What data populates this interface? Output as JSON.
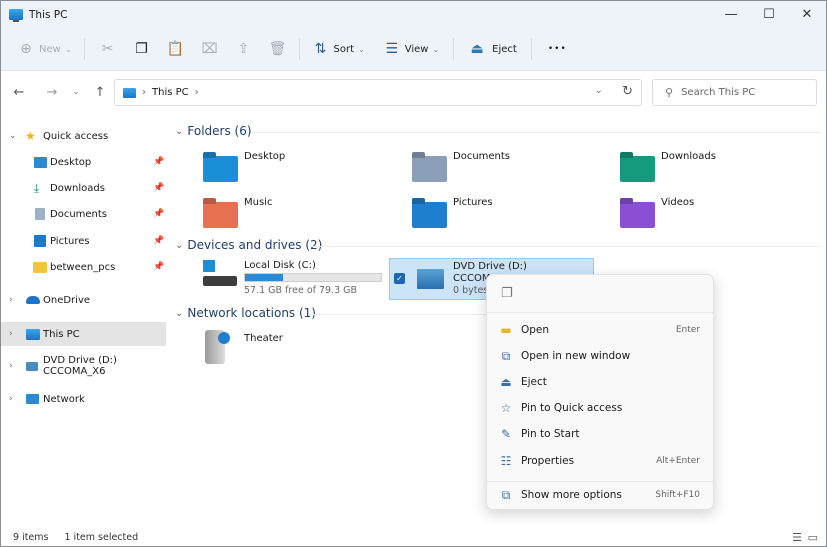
{
  "window": {
    "title": "This PC",
    "minimize": "—",
    "maximize": "☐",
    "close": "✕"
  },
  "toolbar": {
    "new_label": "New",
    "sort_label": "Sort",
    "view_label": "View",
    "eject_label": "Eject",
    "more_label": "•••",
    "icons": [
      "cut-icon",
      "copy-icon",
      "paste-icon",
      "rename-icon",
      "share-icon",
      "delete-icon"
    ]
  },
  "nav": {
    "back": "←",
    "forward": "→",
    "recent": "⌄",
    "up": "↑"
  },
  "address": {
    "crumbs": [
      "This PC"
    ],
    "sep": "›"
  },
  "search": {
    "placeholder": "Search This PC"
  },
  "sidebar": {
    "quick_access": "Quick access",
    "quick_items": [
      {
        "label": "Desktop",
        "color": "#2a8ad4"
      },
      {
        "label": "Downloads",
        "color": "#16907a"
      },
      {
        "label": "Documents",
        "color": "#8fa3bb"
      },
      {
        "label": "Pictures",
        "color": "#1f78cf"
      },
      {
        "label": "between_pcs",
        "color": "#f2c53d"
      }
    ],
    "roots": [
      {
        "label": "OneDrive"
      },
      {
        "label": "This PC",
        "selected": true
      },
      {
        "label": "DVD Drive (D:) CCCOMA_X6"
      },
      {
        "label": "Network"
      }
    ]
  },
  "content": {
    "folders_header": "Folders (6)",
    "folders": [
      {
        "name": "Desktop",
        "color": "#1b8fd6"
      },
      {
        "name": "Documents",
        "color": "#8c9fb8"
      },
      {
        "name": "Downloads",
        "color": "#149a7c"
      },
      {
        "name": "Music",
        "color": "#e6704f"
      },
      {
        "name": "Pictures",
        "color": "#1e7fd0"
      },
      {
        "name": "Videos",
        "color": "#8b4fd6"
      }
    ],
    "drives_header": "Devices and drives (2)",
    "drives": [
      {
        "name": "Local Disk (C:)",
        "detail": "57.1 GB free of 79.3 GB",
        "used_fraction": 0.28
      },
      {
        "name": "DVD Drive (D:)",
        "label2": "CCCOM",
        "detail": "0 bytes",
        "selected": true
      }
    ],
    "network_header": "Network locations (1)",
    "network": [
      {
        "name": "Theater"
      }
    ]
  },
  "context_menu": {
    "items": [
      {
        "label": "Open",
        "accel": "Enter",
        "icon": "folder-icon",
        "glyph": "▬"
      },
      {
        "label": "Open in new window",
        "accel": "",
        "icon": "open-new-window-icon",
        "glyph": "⧉"
      },
      {
        "label": "Eject",
        "accel": "",
        "icon": "eject-icon",
        "glyph": "⏏"
      },
      {
        "label": "Pin to Quick access",
        "accel": "",
        "icon": "star-icon",
        "glyph": "☆"
      },
      {
        "label": "Pin to Start",
        "accel": "",
        "icon": "pin-icon",
        "glyph": "✎"
      },
      {
        "label": "Properties",
        "accel": "Alt+Enter",
        "icon": "properties-icon",
        "glyph": "☷"
      },
      {
        "label": "Show more options",
        "accel": "Shift+F10",
        "icon": "more-options-icon",
        "glyph": "⧉"
      }
    ]
  },
  "status": {
    "items": "9 items",
    "selected": "1 item selected"
  }
}
